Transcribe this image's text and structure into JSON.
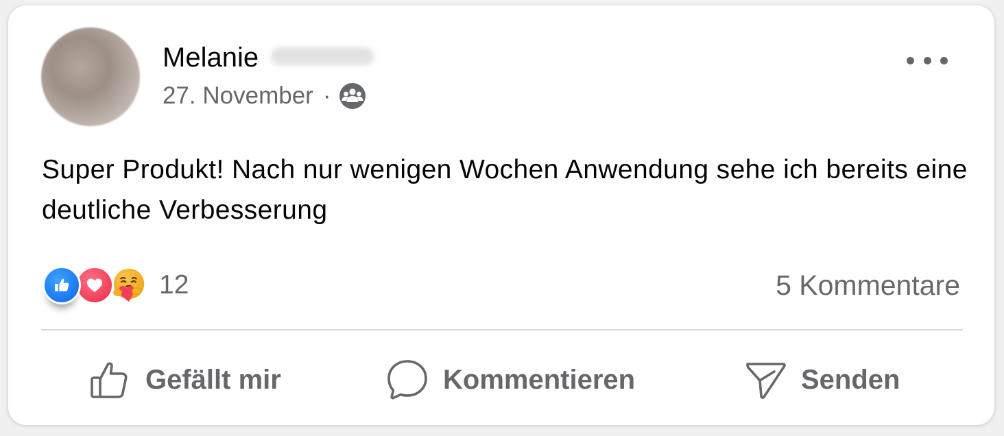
{
  "post": {
    "author_first_name": "Melanie",
    "date": "27. November",
    "separator": "·",
    "audience_icon": "friends-icon",
    "more_icon": "more-options-icon",
    "text": "Super Produkt! Nach nur wenigen Wochen Anwendung sehe ich bereits eine deutliche Verbesserung"
  },
  "reactions": {
    "icons": [
      "like-reaction-icon",
      "love-reaction-icon",
      "care-reaction-icon"
    ],
    "count": "12"
  },
  "comments": {
    "count_label": "5 Kommentare"
  },
  "actions": {
    "like_label": "Gefällt mir",
    "comment_label": "Kommentieren",
    "send_label": "Senden"
  },
  "colors": {
    "text_primary": "#050505",
    "text_secondary": "#65676b",
    "like_blue": "#1877f2",
    "love_red": "#f33e58",
    "divider": "#d3d5d9"
  }
}
